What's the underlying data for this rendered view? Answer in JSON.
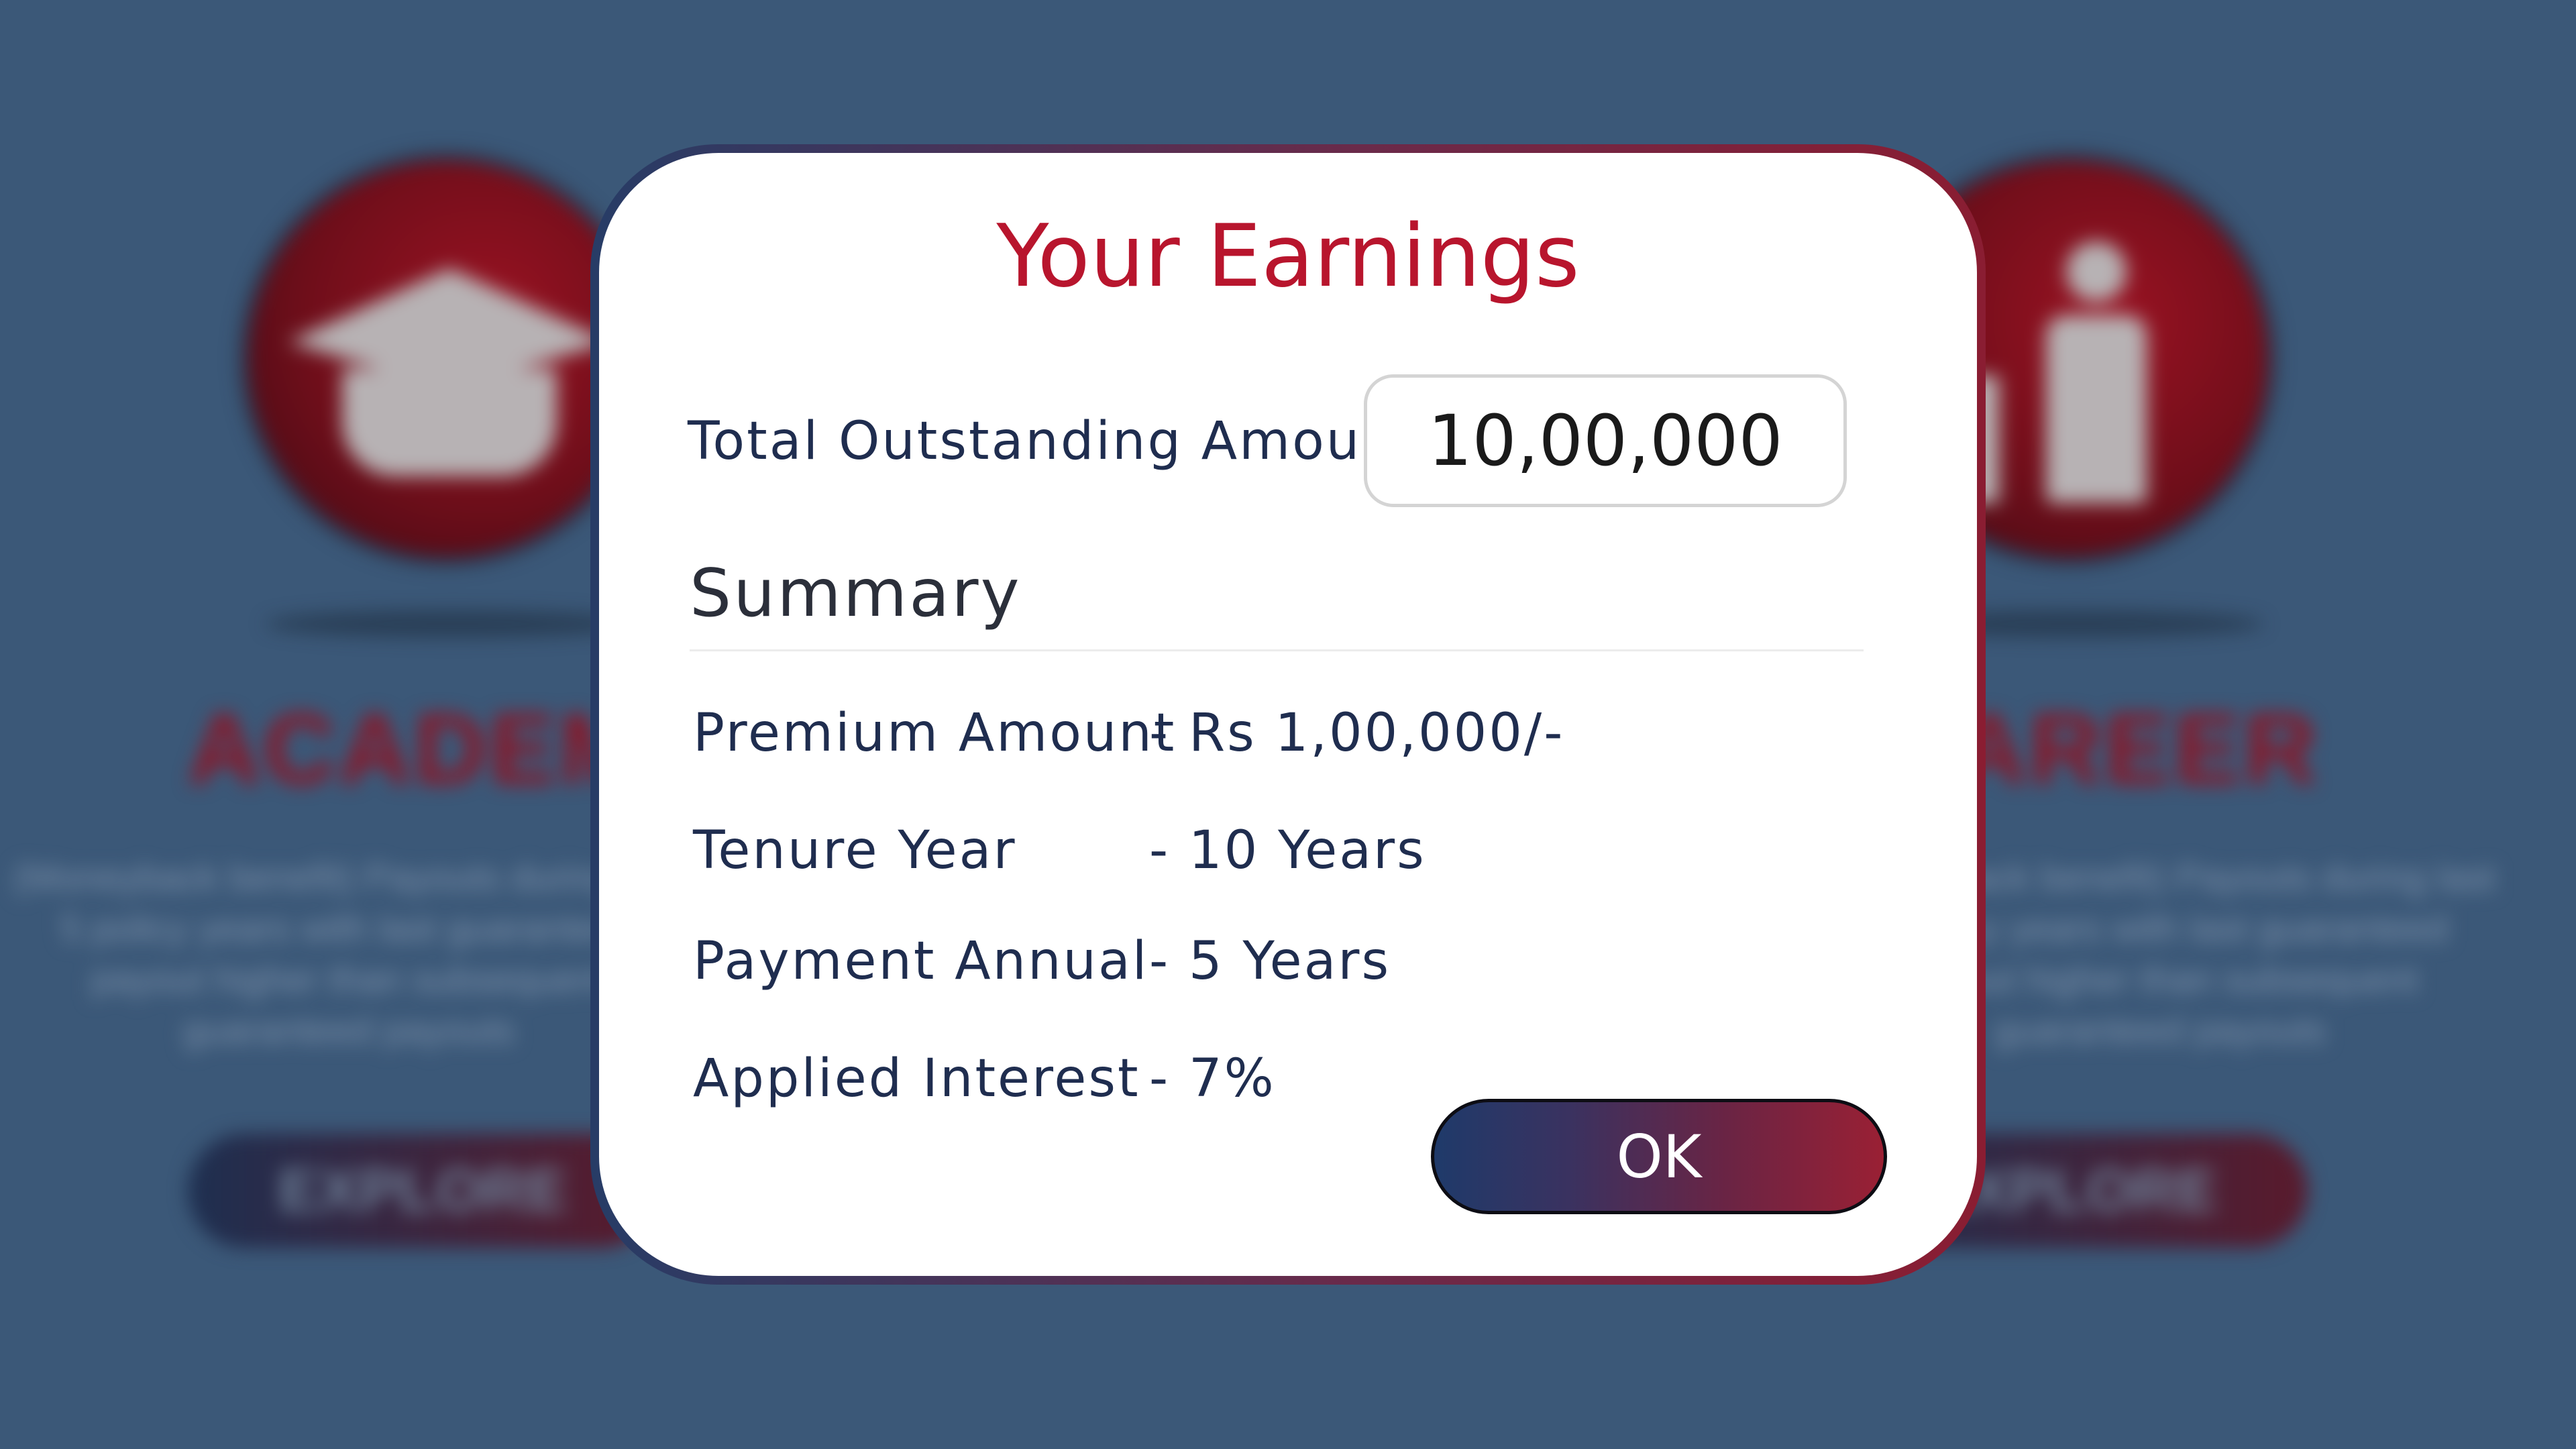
{
  "background": {
    "academic": {
      "title": "ACADEMIC",
      "description": "(Moneyback benefit) Payouts during last 5 policy years with last guaranteed payout higher than subsequent guaranteed payouts",
      "explore_label": "EXPLORE"
    },
    "career": {
      "title": "CAREER",
      "description": "(Moneyback benefit) Payouts during last 5 policy years with last guaranteed payout higher than subsequent guaranteed payouts",
      "explore_label": "EXPLORE"
    }
  },
  "modal": {
    "title": "Your Earnings",
    "total_label": "Total Outstanding Amount",
    "total_value": "10,00,000",
    "summary_heading": "Summary",
    "rows": [
      {
        "label": "Premium Amount",
        "value": "- Rs  1,00,000/-"
      },
      {
        "label": "Tenure Year",
        "value": "-  10 Years"
      },
      {
        "label": "Payment Annual",
        "value": "- 5 Years"
      },
      {
        "label": "Applied Interest",
        "value": "- 7%"
      }
    ],
    "ok_label": "OK"
  },
  "colors": {
    "background": "#3b5878",
    "title_red": "#b8152d",
    "text_navy": "#1f2d4f",
    "button_gradient_start": "#1f3a6a",
    "button_gradient_end": "#9a2034"
  },
  "icons": {
    "academic": "graduation-cap-icon",
    "career": "career-growth-icon"
  }
}
